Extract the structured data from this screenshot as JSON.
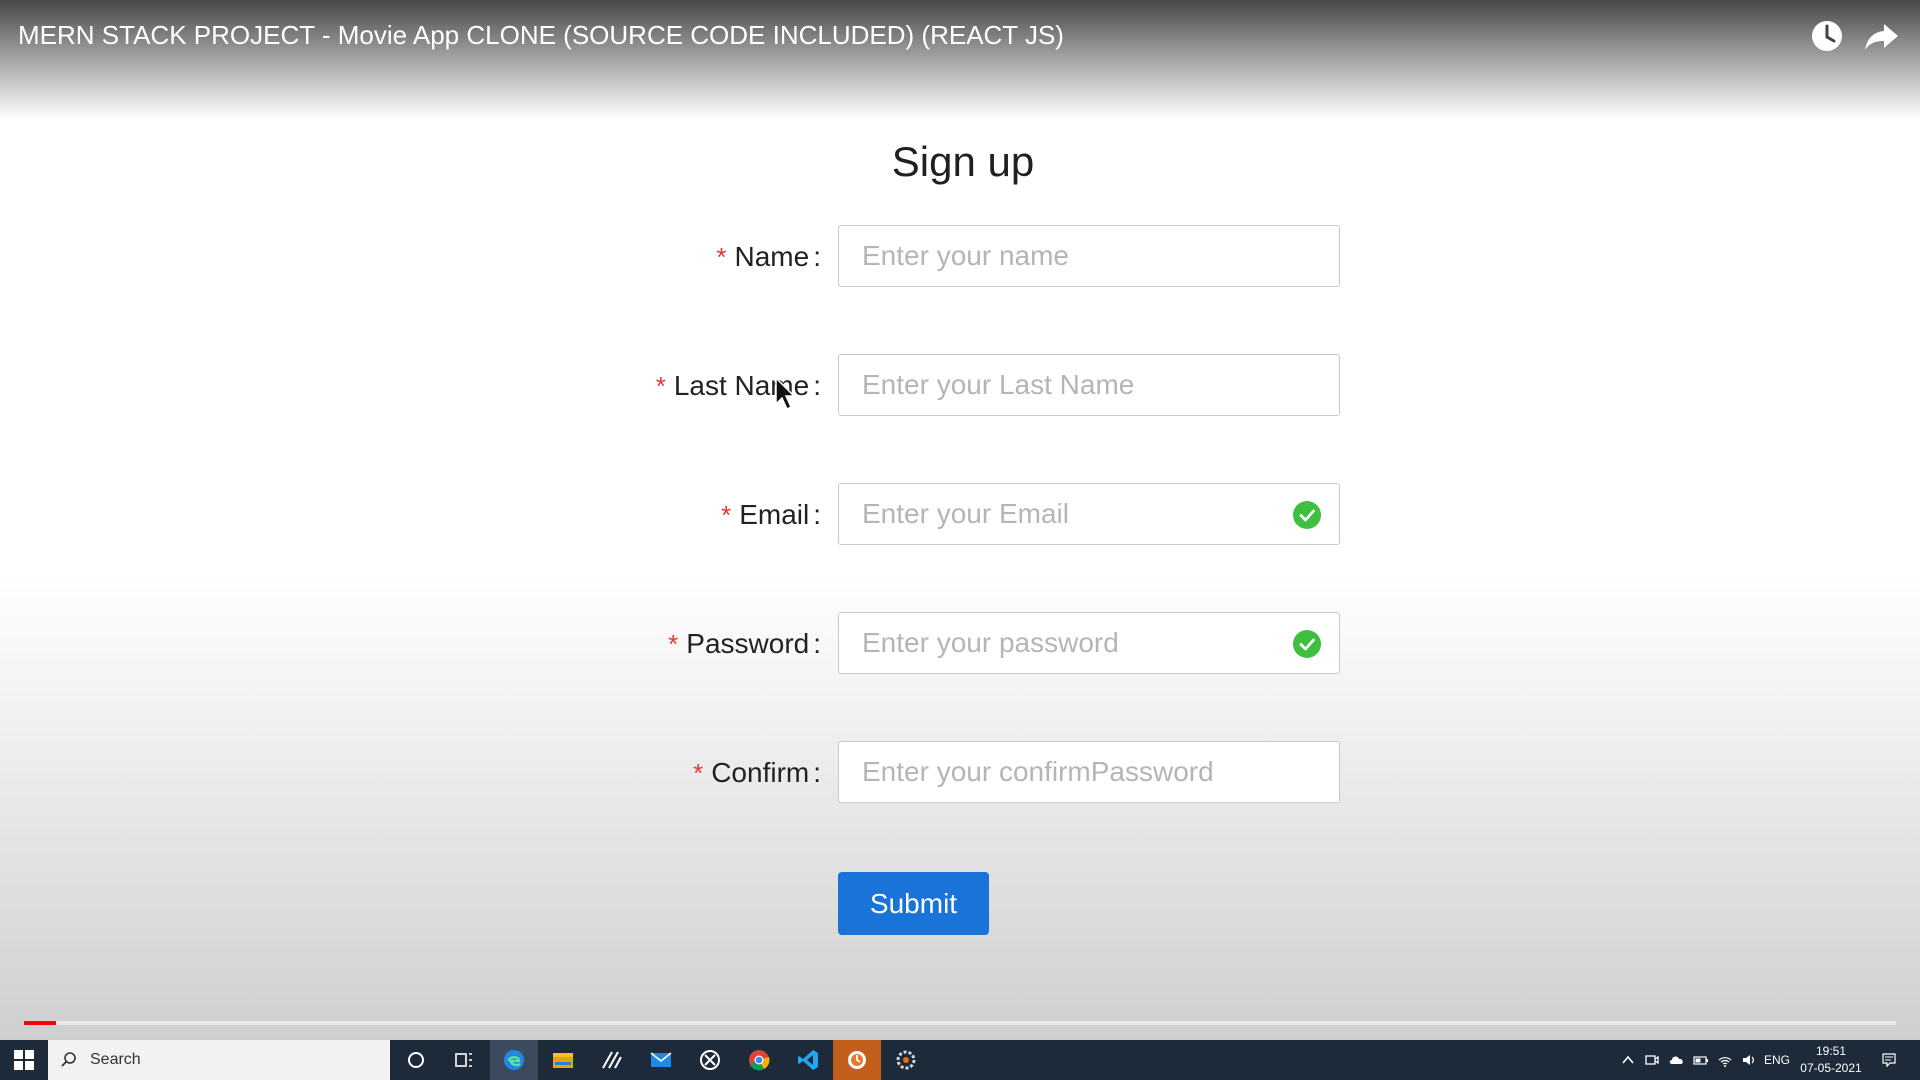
{
  "video": {
    "title": "MERN STACK PROJECT - Movie App CLONE (SOURCE CODE INCLUDED) (REACT JS)",
    "watch_later_icon": "clock-icon",
    "share_icon": "share-arrow-icon",
    "progress_fraction": 0.017
  },
  "form": {
    "title": "Sign up",
    "required_marker": "*",
    "fields": [
      {
        "label": "Name",
        "placeholder": "Enter your name",
        "valid": false
      },
      {
        "label": "Last Name",
        "placeholder": "Enter your Last Name",
        "valid": false
      },
      {
        "label": "Email",
        "placeholder": "Enter your Email",
        "valid": true
      },
      {
        "label": "Password",
        "placeholder": "Enter your password",
        "valid": true
      },
      {
        "label": "Confirm",
        "placeholder": "Enter your confirmPassword",
        "valid": false
      }
    ],
    "colon": ":",
    "submit_label": "Submit",
    "accent_color": "#1a73d9",
    "required_color": "#e53935",
    "valid_color": "#3fbf3f"
  },
  "taskbar": {
    "search_label": "Search",
    "apps": [
      "cortana-icon",
      "task-view-icon",
      "edge-icon",
      "file-explorer-icon",
      "pen-app-icon",
      "mail-icon",
      "xbox-icon",
      "chrome-icon",
      "vscode-icon",
      "app-orange-icon",
      "app-gear-icon"
    ],
    "language": "ENG",
    "time": "19:51",
    "date": "07-05-2021"
  }
}
